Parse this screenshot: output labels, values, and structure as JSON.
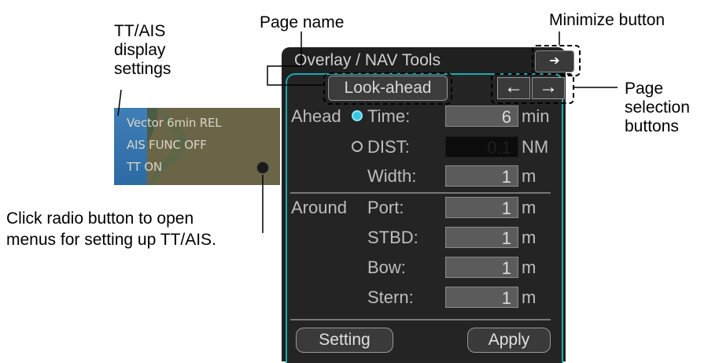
{
  "callouts": {
    "page_name": "Page name",
    "minimize_button": "Minimize button",
    "tt_ais_settings": "TT/AIS\ndisplay\nsettings",
    "page_selection": "Page\nselection\nbuttons",
    "radio_hint": "Click radio button to open\nmenus for setting up TT/AIS."
  },
  "tt_ais": {
    "lines": [
      "Vector 6min REL",
      "AIS FUNC OFF",
      "TT ON"
    ]
  },
  "panel": {
    "title": "Overlay / NAV Tools",
    "minimize_icon": "➔",
    "page_name": "Look-ahead",
    "prev_icon": "←",
    "next_icon": "→",
    "ahead": {
      "label": "Ahead",
      "time_label": "Time:",
      "time_value": "6",
      "time_unit": "min",
      "dist_label": "DIST:",
      "dist_value": "0.1",
      "dist_unit": "NM",
      "width_label": "Width:",
      "width_value": "1",
      "width_unit": "m"
    },
    "around": {
      "label": "Around",
      "port_label": "Port:",
      "port_value": "1",
      "port_unit": "m",
      "stbd_label": "STBD:",
      "stbd_value": "1",
      "stbd_unit": "m",
      "bow_label": "Bow:",
      "bow_value": "1",
      "bow_unit": "m",
      "stern_label": "Stern:",
      "stern_value": "1",
      "stern_unit": "m"
    },
    "setting_button": "Setting",
    "apply_button": "Apply"
  },
  "colors": {
    "panel_bg": "#202020",
    "accent_border": "#1aa9b0",
    "radio_selected": "#33c6e0"
  }
}
